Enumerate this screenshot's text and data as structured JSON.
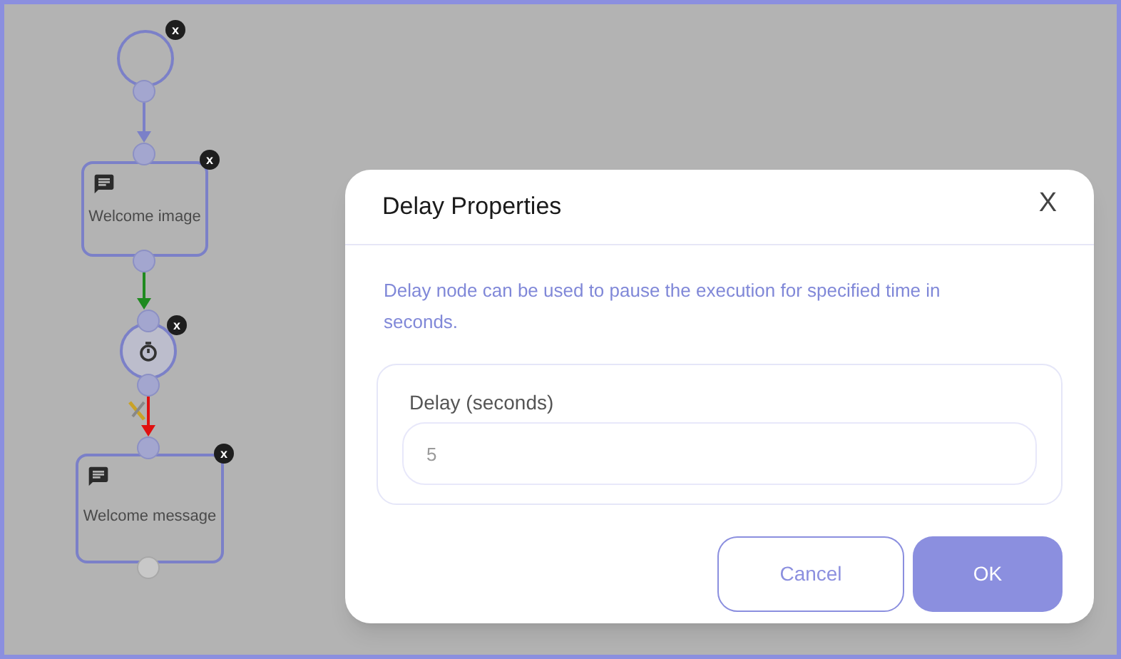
{
  "canvas": {
    "nodes": [
      {
        "kind": "start",
        "badge": "x"
      },
      {
        "kind": "message",
        "label": "Welcome image",
        "badge": "x"
      },
      {
        "kind": "delay",
        "badge": "x"
      },
      {
        "kind": "message",
        "label": "Welcome message",
        "badge": "x"
      }
    ],
    "edges": [
      {
        "color": "#7b80c8"
      },
      {
        "color": "#1f8a1f"
      },
      {
        "color": "#e01010"
      }
    ]
  },
  "dialog": {
    "title": "Delay Properties",
    "close": "X",
    "description": "Delay node can be used to pause the execution for specified time in seconds.",
    "field": {
      "label": "Delay (seconds)",
      "value": "5"
    },
    "buttons": [
      {
        "kind": "secondary",
        "label": "Cancel"
      },
      {
        "kind": "primary",
        "label": "OK"
      }
    ]
  }
}
